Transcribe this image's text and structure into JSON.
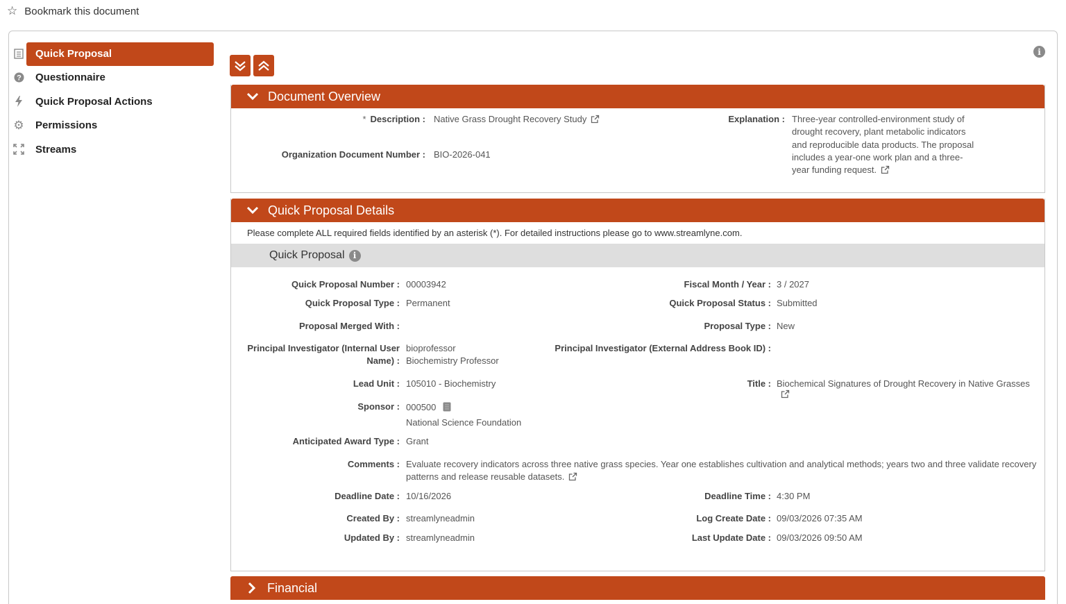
{
  "bookmark": {
    "label": "Bookmark this document"
  },
  "sidebar": {
    "items": [
      {
        "label": "Quick Proposal",
        "icon": "document-icon",
        "active": true
      },
      {
        "label": "Questionnaire",
        "icon": "question-icon"
      },
      {
        "label": "Quick Proposal Actions",
        "icon": "lightning-icon"
      },
      {
        "label": "Permissions",
        "icon": "gear-icon"
      },
      {
        "label": "Streams",
        "icon": "expand-icon"
      }
    ]
  },
  "toolbar": {
    "expand_all": "expand-all-icon",
    "collapse_all": "collapse-all-icon"
  },
  "document_overview": {
    "title": "Document Overview",
    "description_label": "Description :",
    "description_required": "*",
    "description_value": "Native Grass Drought Recovery Study",
    "org_doc_label": "Organization Document Number :",
    "org_doc_value": "BIO-2026-041",
    "explanation_label": "Explanation :",
    "explanation_value": "Three-year controlled-environment study of drought recovery, plant metabolic indicators and reproducible data products. The proposal includes a year-one work plan and a three-year funding request."
  },
  "quick_proposal_details": {
    "title": "Quick Proposal Details",
    "instructions": "Please complete ALL required fields identified by an asterisk (*). For detailed instructions please go to www.streamlyne.com.",
    "subsection": "Quick Proposal",
    "fields": {
      "qp_number_label": "Quick Proposal Number :",
      "qp_number": "00003942",
      "fiscal_label": "Fiscal Month / Year :",
      "fiscal": "3 / 2027",
      "qp_type_label": "Quick Proposal Type :",
      "qp_type": "Permanent",
      "qp_status_label": "Quick Proposal Status :",
      "qp_status": "Submitted",
      "merged_label": "Proposal Merged With :",
      "merged": "",
      "proposal_type_label": "Proposal Type :",
      "proposal_type": "New",
      "pi_internal_label_1": "Principal Investigator (Internal User",
      "pi_internal_label_2": "Name) :",
      "pi_internal_user": "bioprofessor",
      "pi_internal_name": "Biochemistry Professor",
      "pi_external_label": "Principal Investigator (External Address Book ID) :",
      "pi_external": "",
      "lead_unit_label": "Lead Unit :",
      "lead_unit": "105010 - Biochemistry",
      "title_label": "Title :",
      "title": "Biochemical Signatures of Drought Recovery in Native Grasses",
      "sponsor_label": "Sponsor :",
      "sponsor_code": "000500",
      "sponsor_name": "National Science Foundation",
      "award_type_label": "Anticipated Award Type :",
      "award_type": "Grant",
      "comments_label": "Comments :",
      "comments_line1": "Evaluate recovery indicators across three native grass species. Year one establishes cultivation and analytical methods; years two and three validate recovery",
      "comments_line2": "patterns and release reusable datasets.",
      "deadline_date_label": "Deadline Date :",
      "deadline_date": "10/16/2026",
      "deadline_time_label": "Deadline Time :",
      "deadline_time": "4:30 PM",
      "created_by_label": "Created By :",
      "created_by": "streamlyneadmin",
      "log_create_label": "Log Create Date :",
      "log_create": "09/03/2026 07:35 AM",
      "updated_by_label": "Updated By :",
      "updated_by": "streamlyneadmin",
      "last_update_label": "Last Update Date :",
      "last_update": "09/03/2026 09:50 AM"
    }
  },
  "financial": {
    "title": "Financial"
  },
  "colors": {
    "accent": "#c1481a",
    "subbar": "#dedede",
    "border": "#c8c8c8"
  }
}
